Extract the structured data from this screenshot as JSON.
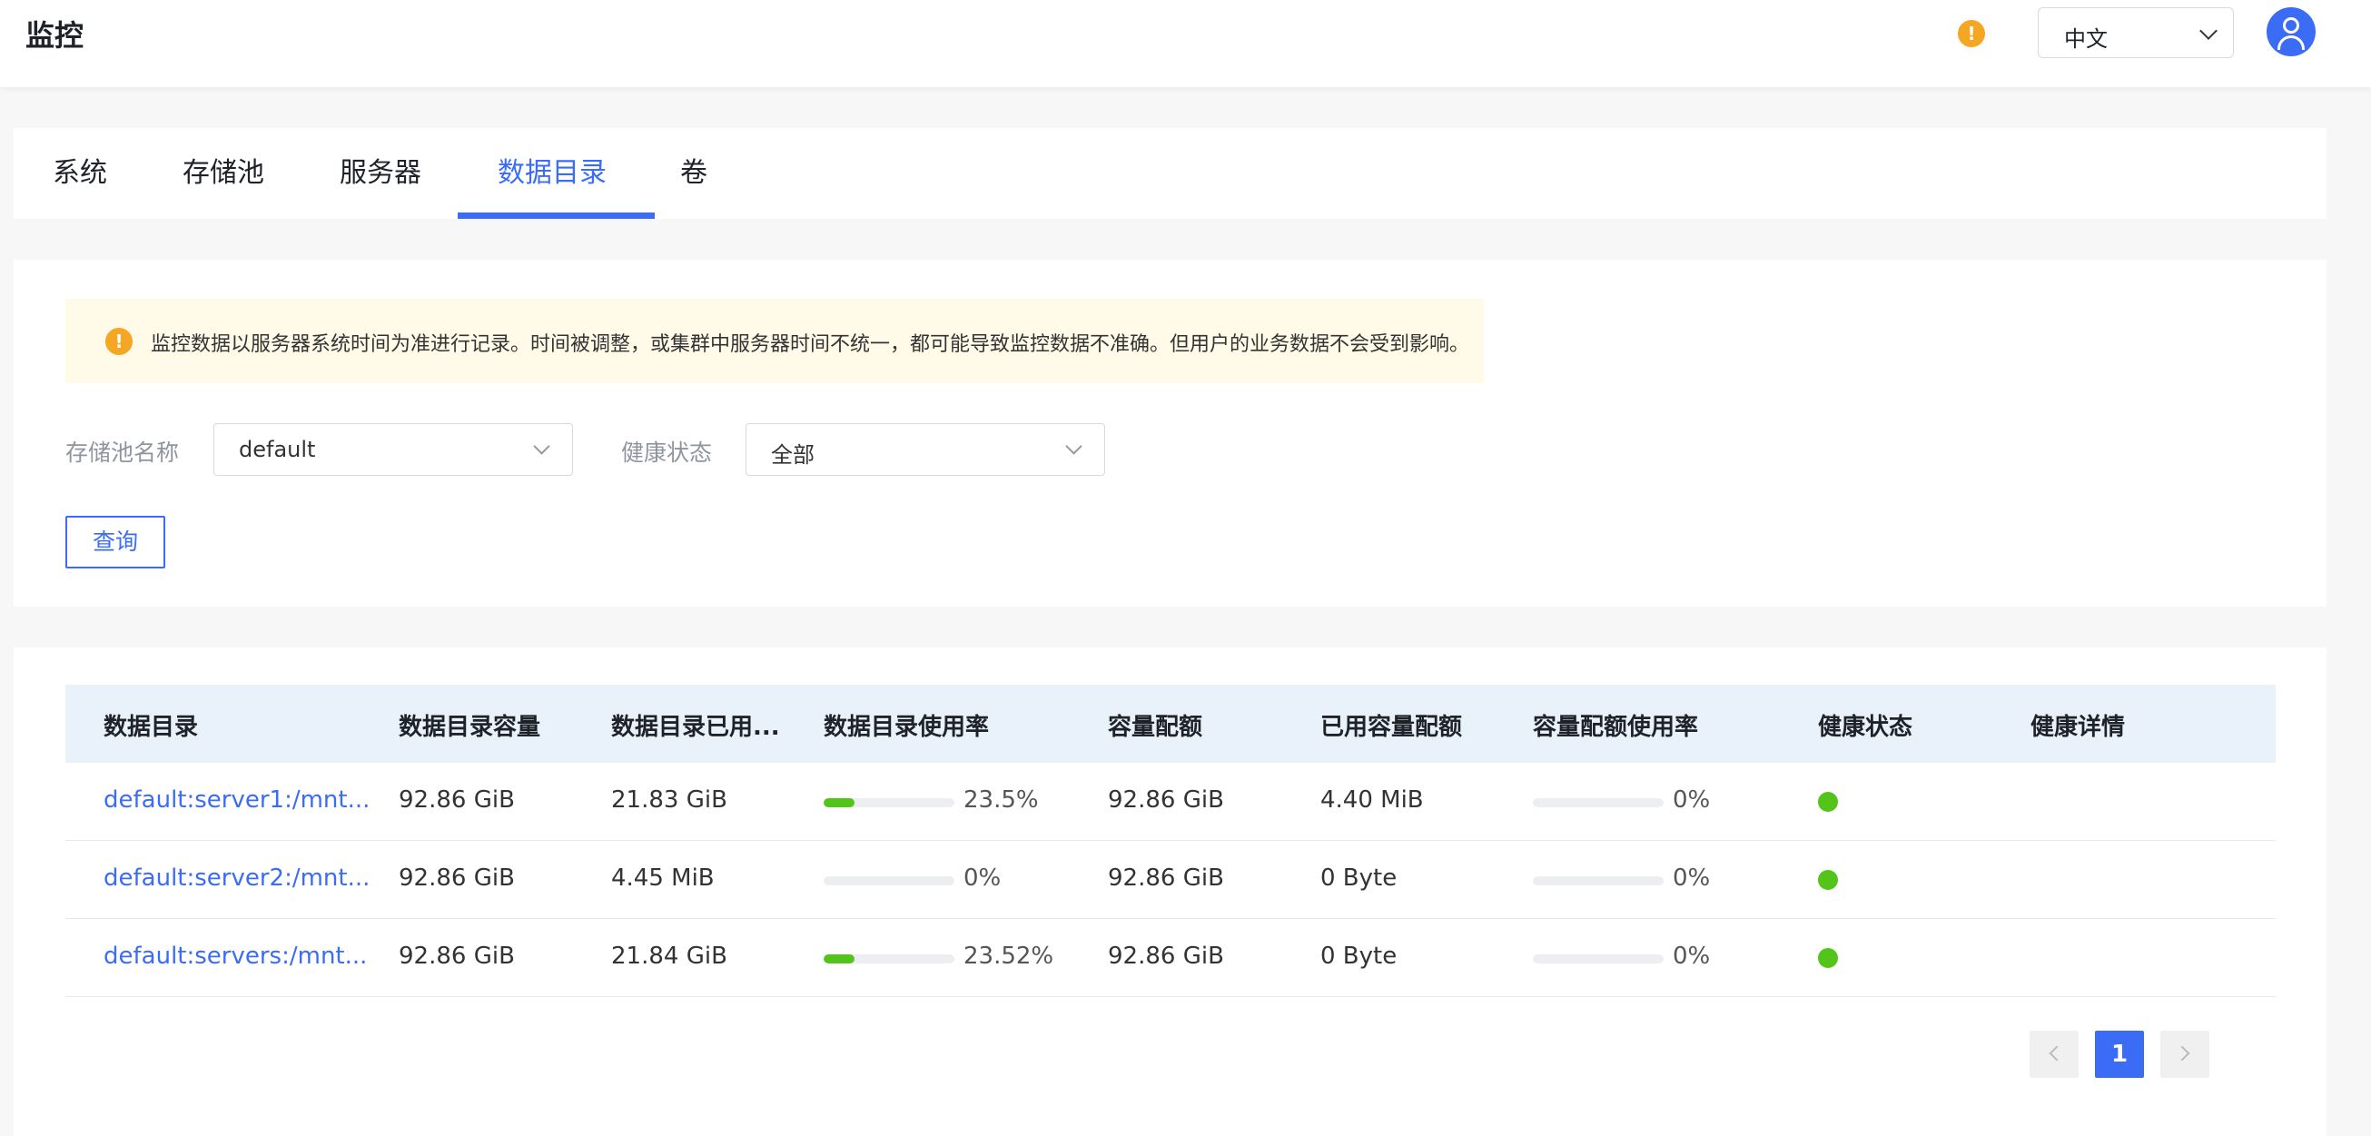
{
  "header": {
    "title": "监控",
    "warning_icon": "!",
    "language": "中文"
  },
  "tabs": [
    {
      "label": "系统",
      "active": false
    },
    {
      "label": "存储池",
      "active": false
    },
    {
      "label": "服务器",
      "active": false
    },
    {
      "label": "数据目录",
      "active": true
    },
    {
      "label": "卷",
      "active": false
    }
  ],
  "notice": {
    "icon": "!",
    "text": "监控数据以服务器系统时间为准进行记录。时间被调整，或集群中服务器时间不统一，都可能导致监控数据不准确。但用户的业务数据不会受到影响。"
  },
  "filters": {
    "pool_label": "存储池名称",
    "pool_value": "default",
    "health_label": "健康状态",
    "health_value": "全部",
    "query_label": "查询"
  },
  "table": {
    "columns": [
      "数据目录",
      "数据目录容量",
      "数据目录已用...",
      "数据目录使用率",
      "容量配额",
      "已用容量配额",
      "容量配额使用率",
      "健康状态",
      "健康详情"
    ],
    "rows": [
      {
        "dir": "default:server1:/mnt...",
        "capacity": "92.86 GiB",
        "used": "21.83 GiB",
        "usage_pct": "23.5%",
        "usage_value": 23.5,
        "quota": "92.86 GiB",
        "quota_used": "4.40 MiB",
        "quota_pct": "0%",
        "quota_value": 0,
        "health": "healthy",
        "detail": ""
      },
      {
        "dir": "default:server2:/mnt...",
        "capacity": "92.86 GiB",
        "used": "4.45 MiB",
        "usage_pct": "0%",
        "usage_value": 0,
        "quota": "92.86 GiB",
        "quota_used": "0 Byte",
        "quota_pct": "0%",
        "quota_value": 0,
        "health": "healthy",
        "detail": ""
      },
      {
        "dir": "default:servers:/mnt...",
        "capacity": "92.86 GiB",
        "used": "21.84 GiB",
        "usage_pct": "23.52%",
        "usage_value": 23.52,
        "quota": "92.86 GiB",
        "quota_used": "0 Byte",
        "quota_pct": "0%",
        "quota_value": 0,
        "health": "healthy",
        "detail": ""
      }
    ]
  },
  "pagination": {
    "current": "1"
  },
  "colors": {
    "accent": "#3b6cf6",
    "healthy": "#52c41a",
    "warning": "#f5a623"
  }
}
